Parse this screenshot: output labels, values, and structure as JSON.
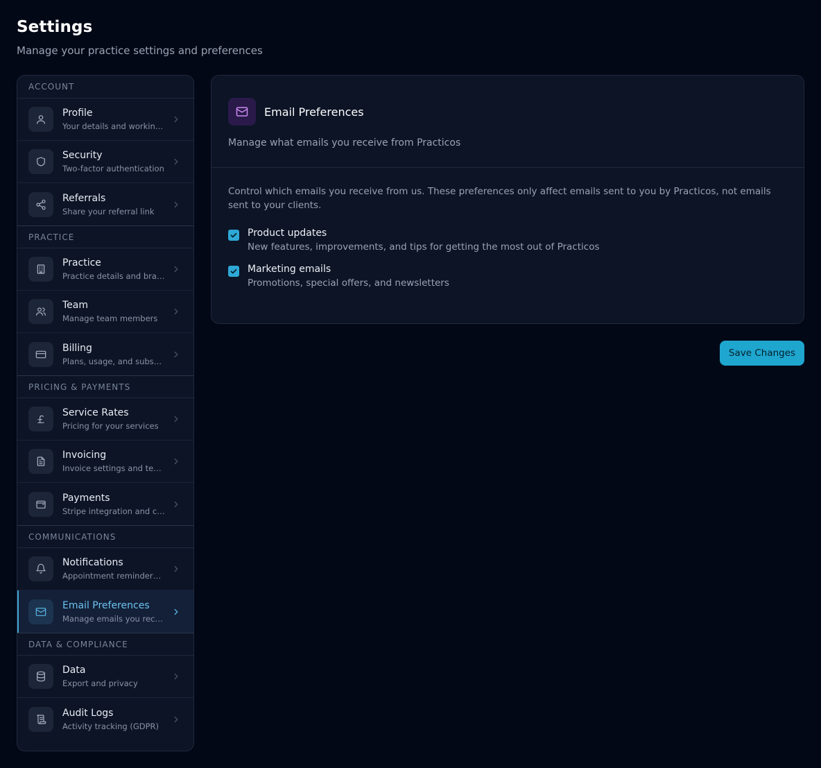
{
  "page": {
    "title": "Settings",
    "subtitle": "Manage your practice settings and preferences"
  },
  "sidebar": {
    "sections": [
      {
        "header": "ACCOUNT",
        "items": [
          {
            "label": "Profile",
            "desc": "Your details and working hours",
            "icon": "user-icon"
          },
          {
            "label": "Security",
            "desc": "Two-factor authentication",
            "icon": "shield-icon"
          },
          {
            "label": "Referrals",
            "desc": "Share your referral link",
            "icon": "share-icon"
          }
        ]
      },
      {
        "header": "PRACTICE",
        "items": [
          {
            "label": "Practice",
            "desc": "Practice details and branding",
            "icon": "building-icon"
          },
          {
            "label": "Team",
            "desc": "Manage team members",
            "icon": "users-icon"
          },
          {
            "label": "Billing",
            "desc": "Plans, usage, and subscription",
            "icon": "credit-card-icon"
          }
        ]
      },
      {
        "header": "PRICING & PAYMENTS",
        "items": [
          {
            "label": "Service Rates",
            "desc": "Pricing for your services",
            "icon": "pound-icon"
          },
          {
            "label": "Invoicing",
            "desc": "Invoice settings and templates",
            "icon": "file-text-icon"
          },
          {
            "label": "Payments",
            "desc": "Stripe integration and card payments",
            "icon": "wallet-icon"
          }
        ]
      },
      {
        "header": "COMMUNICATIONS",
        "items": [
          {
            "label": "Notifications",
            "desc": "Appointment reminders and alerts",
            "icon": "bell-icon"
          },
          {
            "label": "Email Preferences",
            "desc": "Manage emails you receive",
            "icon": "mail-icon",
            "active": true
          }
        ]
      },
      {
        "header": "DATA & COMPLIANCE",
        "items": [
          {
            "label": "Data",
            "desc": "Export and privacy",
            "icon": "database-icon"
          },
          {
            "label": "Audit Logs",
            "desc": "Activity tracking (GDPR)",
            "icon": "scroll-icon"
          }
        ]
      }
    ]
  },
  "card": {
    "title": "Email Preferences",
    "subtitle": "Manage what emails you receive from Practicos",
    "intro": "Control which emails you receive from us. These preferences only affect emails sent to you by Practicos, not emails sent to your clients.",
    "preferences": [
      {
        "label": "Product updates",
        "desc": "New features, improvements, and tips for getting the most out of Practicos",
        "checked": true
      },
      {
        "label": "Marketing emails",
        "desc": "Promotions, special offers, and newsletters",
        "checked": true
      }
    ]
  },
  "actions": {
    "save_label": "Save Changes"
  },
  "colors": {
    "background": "#030816",
    "accent": "#1ea6cf",
    "active_text": "#6cc3ef"
  }
}
